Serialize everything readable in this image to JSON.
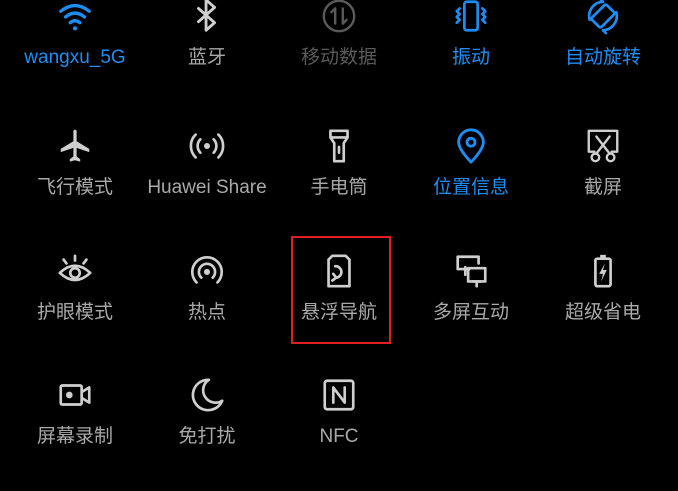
{
  "accent_color": "#1c8ef3",
  "inactive_color": "#a9a9a9",
  "disabled_color": "#5a5a5a",
  "highlight_color": "#e02020",
  "tiles": [
    {
      "label": "wangxu_5G",
      "icon": "wifi-icon",
      "state": "on"
    },
    {
      "label": "蓝牙",
      "icon": "bluetooth-icon",
      "state": "off"
    },
    {
      "label": "移动数据",
      "icon": "mobile-data-icon",
      "state": "disabled"
    },
    {
      "label": "振动",
      "icon": "vibrate-icon",
      "state": "on"
    },
    {
      "label": "自动旋转",
      "icon": "auto-rotate-icon",
      "state": "on"
    },
    {
      "label": "飞行模式",
      "icon": "airplane-icon",
      "state": "off"
    },
    {
      "label": "Huawei Share",
      "icon": "huawei-share-icon",
      "state": "off"
    },
    {
      "label": "手电筒",
      "icon": "flashlight-icon",
      "state": "off"
    },
    {
      "label": "位置信息",
      "icon": "location-icon",
      "state": "on"
    },
    {
      "label": "截屏",
      "icon": "screenshot-icon",
      "state": "off"
    },
    {
      "label": "护眼模式",
      "icon": "eye-comfort-icon",
      "state": "off"
    },
    {
      "label": "热点",
      "icon": "hotspot-icon",
      "state": "off"
    },
    {
      "label": "悬浮导航",
      "icon": "floating-nav-icon",
      "state": "off",
      "highlighted": true
    },
    {
      "label": "多屏互动",
      "icon": "multi-screen-icon",
      "state": "off"
    },
    {
      "label": "超级省电",
      "icon": "battery-saver-icon",
      "state": "off"
    },
    {
      "label": "屏幕录制",
      "icon": "screen-record-icon",
      "state": "off"
    },
    {
      "label": "免打扰",
      "icon": "do-not-disturb-icon",
      "state": "off"
    },
    {
      "label": "NFC",
      "icon": "nfc-icon",
      "state": "off"
    }
  ]
}
